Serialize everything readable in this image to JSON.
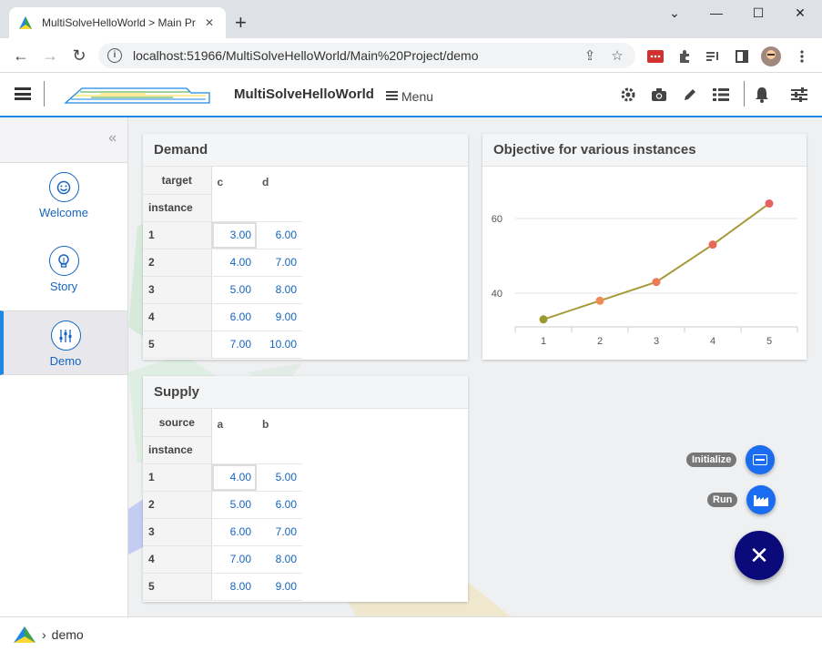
{
  "browser": {
    "tab_title": "MultiSolveHelloWorld > Main Pr",
    "new_tab": "+",
    "close_tab": "✕",
    "url": "localhost:51966/MultiSolveHelloWorld/Main%20Project/demo"
  },
  "header": {
    "app_title": "MultiSolveHelloWorld",
    "menu_label": "Menu"
  },
  "sidebar": {
    "collapse": "«",
    "items": [
      {
        "label": "Welcome",
        "icon": "smiley-icon"
      },
      {
        "label": "Story",
        "icon": "lightbulb-icon"
      },
      {
        "label": "Demo",
        "icon": "sliders-icon"
      }
    ]
  },
  "demand": {
    "title": "Demand",
    "col_header": "target",
    "row_header": "instance",
    "columns": [
      "c",
      "d"
    ],
    "rows": [
      {
        "instance": "1",
        "values": [
          "3.00",
          "6.00"
        ]
      },
      {
        "instance": "2",
        "values": [
          "4.00",
          "7.00"
        ]
      },
      {
        "instance": "3",
        "values": [
          "5.00",
          "8.00"
        ]
      },
      {
        "instance": "4",
        "values": [
          "6.00",
          "9.00"
        ]
      },
      {
        "instance": "5",
        "values": [
          "7.00",
          "10.00"
        ]
      }
    ]
  },
  "supply": {
    "title": "Supply",
    "col_header": "source",
    "row_header": "instance",
    "columns": [
      "a",
      "b"
    ],
    "rows": [
      {
        "instance": "1",
        "values": [
          "4.00",
          "5.00"
        ]
      },
      {
        "instance": "2",
        "values": [
          "5.00",
          "6.00"
        ]
      },
      {
        "instance": "3",
        "values": [
          "6.00",
          "7.00"
        ]
      },
      {
        "instance": "4",
        "values": [
          "7.00",
          "8.00"
        ]
      },
      {
        "instance": "5",
        "values": [
          "8.00",
          "9.00"
        ]
      }
    ]
  },
  "objective": {
    "title": "Objective for various instances"
  },
  "chart_data": {
    "type": "line",
    "title": "Objective for various instances",
    "categories": [
      "1",
      "2",
      "3",
      "4",
      "5"
    ],
    "series": [
      {
        "values": [
          33,
          38,
          43,
          53,
          64
        ]
      }
    ],
    "yticks": [
      "40",
      "60"
    ],
    "ylim": [
      31,
      69
    ],
    "line_color": "#a89a3a",
    "point_colors": [
      "#9a9a30",
      "#ee8a55",
      "#ee7a55",
      "#e86a55",
      "#e86060"
    ],
    "grid": true
  },
  "actions": {
    "initialize_label": "Initialize",
    "run_label": "Run",
    "close_symbol": "✕"
  },
  "footer": {
    "path": "demo",
    "separator": "›"
  },
  "colors": {
    "accent": "#1e88e5",
    "link": "#1565c0",
    "fab_dark": "#0a0a7a",
    "fab_blue": "#1a6cf0"
  }
}
